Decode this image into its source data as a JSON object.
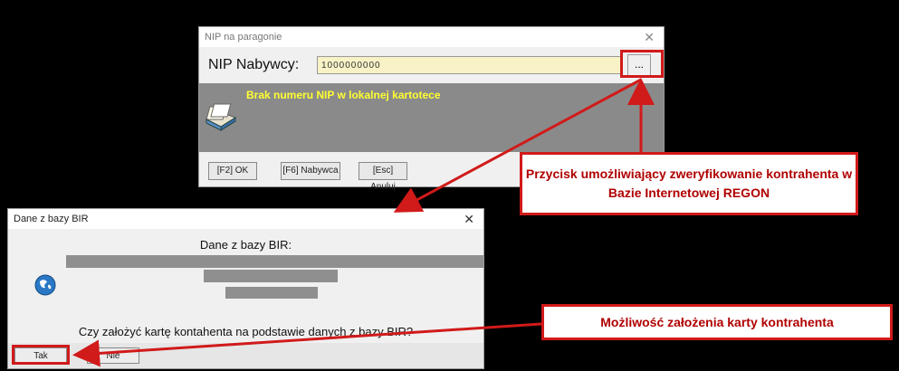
{
  "dialog_nip": {
    "title": "NIP na paragonie",
    "close": "✕",
    "nip_label": "NIP Nabywcy:",
    "nip_value": "1000000000",
    "browse_button": "...",
    "info_message": "Brak numeru NIP w lokalnej kartotece",
    "buttons": {
      "ok": "[F2] OK",
      "nabywca": "[F6] Nabywca",
      "anuluj": "[Esc] Anuluj"
    }
  },
  "dialog_bir": {
    "title": "Dane z bazy BIR",
    "close": "✕",
    "heading": "Dane z bazy BIR:",
    "question": "Czy założyć kartę kontahenta na podstawie danych z bazy BIR?",
    "buttons": {
      "yes": "Tak",
      "no": "Nie"
    }
  },
  "callouts": {
    "verify": "Przycisk umożliwiający zweryfikowanie kontrahenta w Bazie Internetowej REGON",
    "create": "Możliwość założenia karty kontrahenta"
  },
  "colors": {
    "highlight": "#d11a1a",
    "info_text": "#ffff33",
    "nip_field_bg": "#f8f2c6"
  }
}
